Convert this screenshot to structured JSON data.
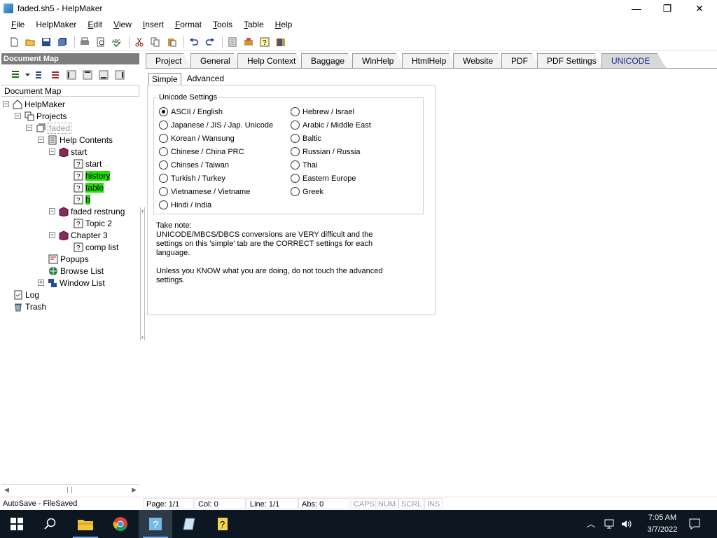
{
  "window": {
    "title": "faded.sh5 - HelpMaker",
    "minimize": "—",
    "maximize": "❐",
    "close": "✕"
  },
  "menu": [
    {
      "label": "File",
      "u": "F",
      "rest": "ile"
    },
    {
      "label": "HelpMaker",
      "u": "",
      "rest": "HelpMaker"
    },
    {
      "label": "Edit",
      "u": "E",
      "rest": "dit"
    },
    {
      "label": "View",
      "u": "V",
      "rest": "iew"
    },
    {
      "label": "Insert",
      "u": "I",
      "rest": "nsert"
    },
    {
      "label": "Format",
      "u": "F",
      "rest": "ormat"
    },
    {
      "label": "Tools",
      "u": "T",
      "rest": "ools"
    },
    {
      "label": "Table",
      "u": "T",
      "rest": "able"
    },
    {
      "label": "Help",
      "u": "H",
      "rest": "elp"
    }
  ],
  "left_pane": {
    "header": "Document Map",
    "tree_label": "Document Map",
    "tree": {
      "helpmaker": "HelpMaker",
      "projects": "Projects",
      "faded": "faded",
      "help_contents": "Help Contents",
      "start_book": "start",
      "start_topic": "start",
      "history": "history",
      "table": "table",
      "b": "b",
      "faded_restrung": "faded restrung",
      "topic2": "Topic 2",
      "chapter3": "Chapter 3",
      "comp_list": "comp list",
      "popups": "Popups",
      "browse_list": "Browse List",
      "window_list": "Window List",
      "log": "Log",
      "trash": "Trash"
    }
  },
  "tabs": [
    "Project",
    "General",
    "Help Context",
    "Baggage",
    "WinHelp",
    "HtmlHelp",
    "Website",
    "PDF",
    "PDF Settings",
    "UNICODE"
  ],
  "active_tab": "UNICODE",
  "subtabs": [
    "Simple",
    "Advanced"
  ],
  "unicode": {
    "legend": "Unicode Settings",
    "left": [
      "ASCII / English",
      "Japanese / JIS / Jap. Unicode",
      "Korean / Wansung",
      "Chinese / China PRC",
      "Chinses / Taiwan",
      "Turkish / Turkey",
      "Vietnamese / Vietname",
      "Hindi / India"
    ],
    "right": [
      "Hebrew / Israel",
      "Arabic / Middle East",
      "Baltic",
      "Russian / Russia",
      "Thai",
      "Eastern Europe",
      "Greek"
    ],
    "selected": "ASCII / English"
  },
  "note": {
    "p1_line1": "Take note:",
    "p1_line2": "UNICODE/MBCS/DBCS conversions are VERY difficult and the",
    "p1_line3": "settings on this 'simple' tab are the CORRECT settings for each",
    "p1_line4": "language.",
    "p2_line1": "Unless you KNOW what you are doing, do not touch the advanced",
    "p2_line2": "settings."
  },
  "status": {
    "autosave": "AutoSave - FileSaved",
    "page": "Page: 1/1",
    "col": "Col: 0",
    "line": "Line: 1/1",
    "abs": "Abs: 0",
    "caps": "CAPS",
    "num": "NUM",
    "scrl": "SCRL",
    "ins": "INS"
  },
  "taskbar": {
    "time": "7:05 AM",
    "date": "3/7/2022"
  },
  "colors": {
    "highlight": "#22e000",
    "taskbar": "#0d1721",
    "docmap_header": "#7d7d7d"
  }
}
